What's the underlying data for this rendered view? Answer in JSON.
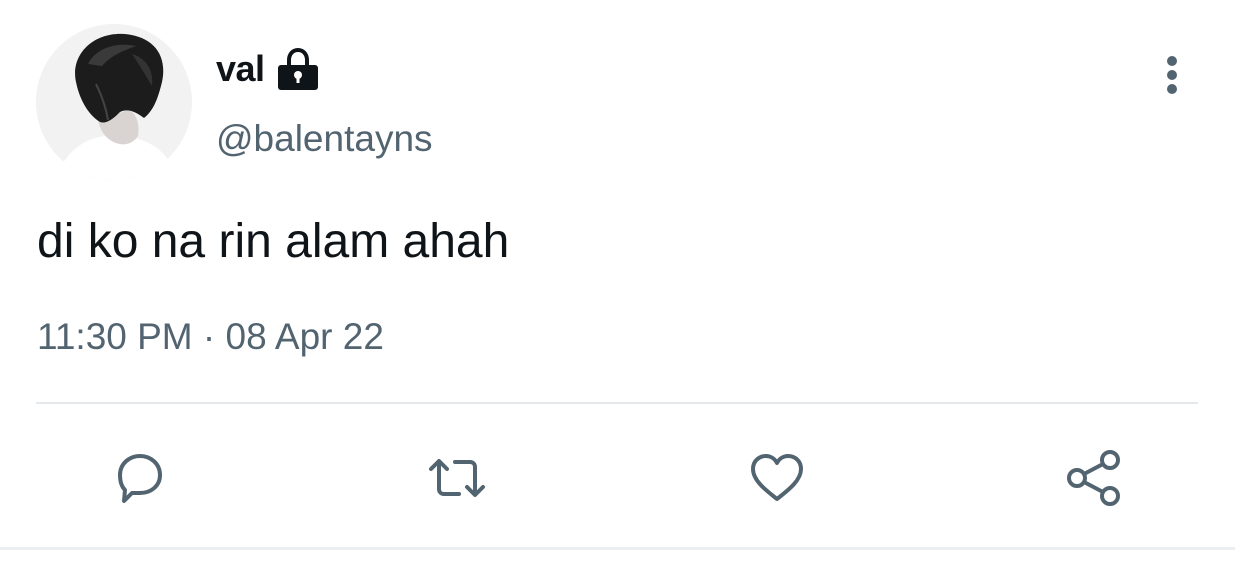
{
  "user": {
    "display_name": "val",
    "handle": "@balentayns",
    "protected_icon": "lock-icon",
    "avatar": "profile-photo"
  },
  "tweet": {
    "text": "di ko na rin alam ahah",
    "time": "11:30 PM",
    "separator": " · ",
    "date": "08 Apr 22"
  },
  "actions": [
    {
      "name": "reply",
      "icon": "reply-bubble-icon"
    },
    {
      "name": "retweet",
      "icon": "retweet-icon"
    },
    {
      "name": "like",
      "icon": "heart-icon"
    },
    {
      "name": "share",
      "icon": "share-icon"
    }
  ],
  "menu": {
    "icon": "more-vertical-icon"
  },
  "colors": {
    "text_primary": "#0f1419",
    "text_secondary": "#536471",
    "divider": "#e6e9ec"
  }
}
